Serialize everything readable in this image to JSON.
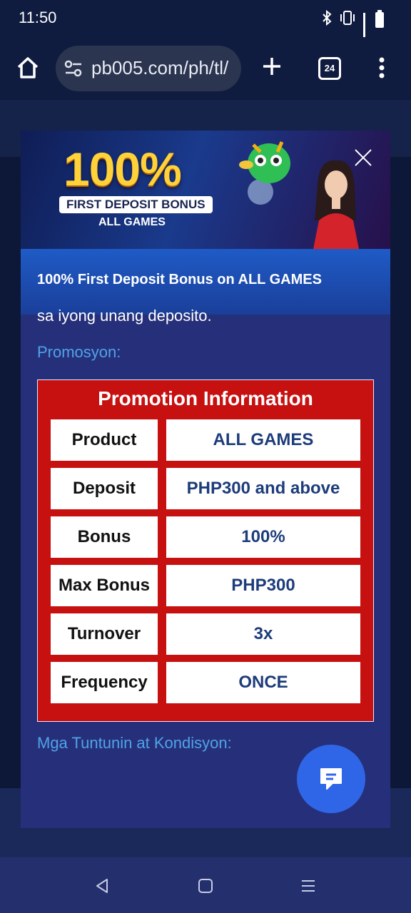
{
  "status": {
    "time": "11:50"
  },
  "browser": {
    "url": "pb005.com/ph/tl/",
    "tab_count": "24"
  },
  "banner": {
    "headline": "100%",
    "subtitle": "FIRST DEPOSIT BONUS",
    "tagline": "ALL GAMES"
  },
  "modal": {
    "title": "100% First Deposit Bonus on ALL GAMES",
    "clipped_text": "sa iyong unang deposito.",
    "promo_label": "Promosyon:",
    "terms_label": "Mga Tuntunin at Kondisyon:"
  },
  "promo_table": {
    "title": "Promotion Information",
    "rows": [
      {
        "key": "Product",
        "value": "ALL GAMES"
      },
      {
        "key": "Deposit",
        "value": "PHP300 and above"
      },
      {
        "key": "Bonus",
        "value": "100%"
      },
      {
        "key": "Max Bonus",
        "value": "PHP300"
      },
      {
        "key": "Turnover",
        "value": "3x"
      },
      {
        "key": "Frequency",
        "value": "ONCE"
      }
    ]
  }
}
